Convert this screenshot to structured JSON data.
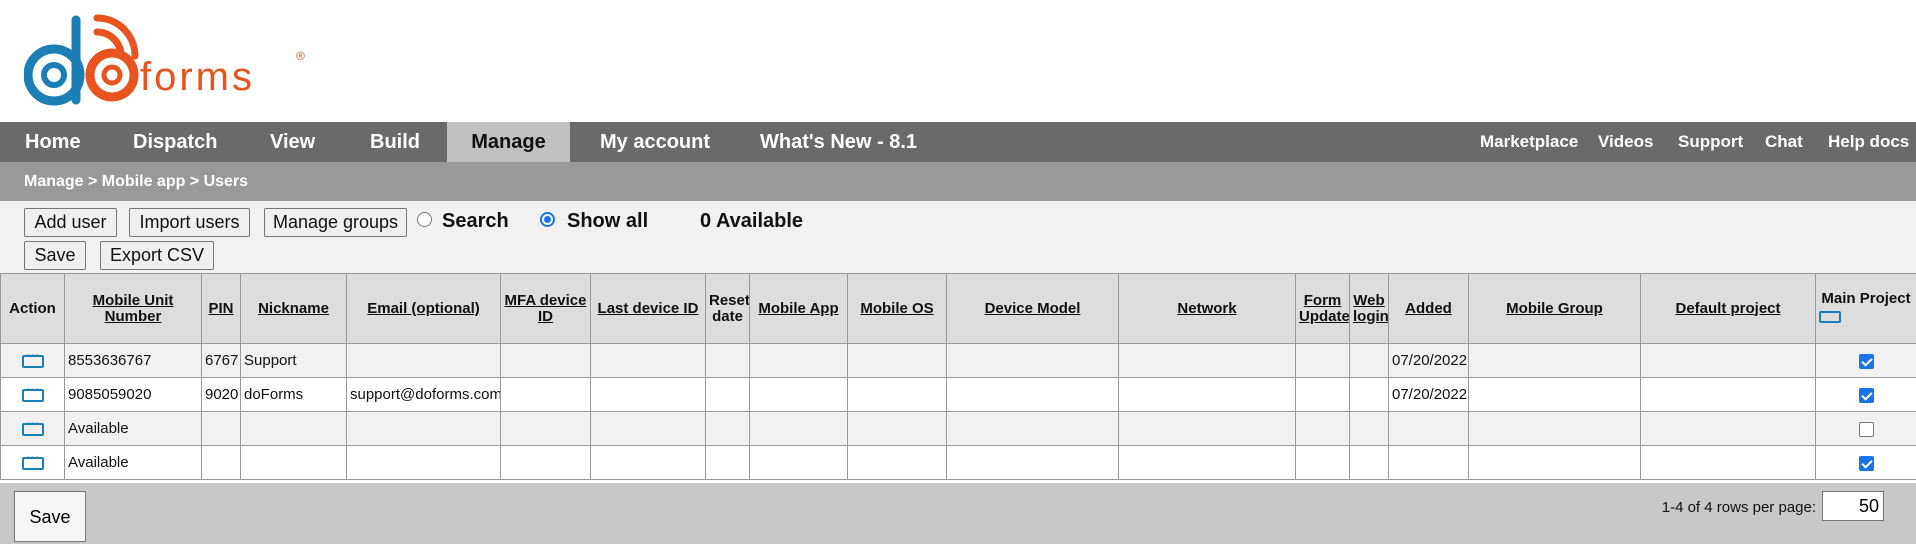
{
  "logo": {
    "text_do": "do",
    "text_forms": "forms",
    "registered": "®",
    "colors": {
      "blue": "#1b7fb6",
      "orange": "#e8531e"
    }
  },
  "nav": {
    "items": [
      {
        "label": "Home"
      },
      {
        "label": "Dispatch"
      },
      {
        "label": "View"
      },
      {
        "label": "Build"
      },
      {
        "label": "Manage",
        "active": true
      },
      {
        "label": "My account"
      },
      {
        "label": "What's New - 8.1"
      }
    ],
    "right_items": [
      {
        "label": "Marketplace"
      },
      {
        "label": "Videos"
      },
      {
        "label": "Support"
      },
      {
        "label": "Chat"
      },
      {
        "label": "Help docs"
      }
    ]
  },
  "breadcrumb": "Manage > Mobile app > Users",
  "toolbar": {
    "add_user": "Add user",
    "import_users": "Import users",
    "manage_groups": "Manage groups",
    "radio_search": "Search",
    "radio_show_all": "Show all",
    "available_count": "0 Available",
    "save": "Save",
    "export_csv": "Export CSV"
  },
  "table": {
    "headers": {
      "action": "Action",
      "mobile_unit_number": "Mobile Unit Number",
      "pin": "PIN",
      "nickname": "Nickname",
      "email": "Email (optional)",
      "mfa_device_id": "MFA device ID",
      "last_device_id": "Last device ID",
      "reset_date": "Reset date",
      "mobile_app": "Mobile App",
      "mobile_os": "Mobile OS",
      "device_model": "Device Model",
      "network": "Network",
      "form_update": "Form Update",
      "web_login": "Web login",
      "added": "Added",
      "mobile_group": "Mobile Group",
      "default_project": "Default project",
      "main_project": "Main Project"
    },
    "rows": [
      {
        "unit": "8553636767",
        "pin": "6767",
        "nickname": "Support",
        "email": "",
        "added": "07/20/2022",
        "main_project": true
      },
      {
        "unit": "9085059020",
        "pin": "9020",
        "nickname": "doForms",
        "email": "support@doforms.com",
        "added": "07/20/2022",
        "main_project": true
      },
      {
        "unit": "Available",
        "pin": "",
        "nickname": "",
        "email": "",
        "added": "",
        "main_project": false
      },
      {
        "unit": "Available",
        "pin": "",
        "nickname": "",
        "email": "",
        "added": "",
        "main_project": true
      }
    ]
  },
  "footer": {
    "save": "Save",
    "pager_text": "1-4 of 4 rows per page:",
    "rows_per_page": "50"
  }
}
